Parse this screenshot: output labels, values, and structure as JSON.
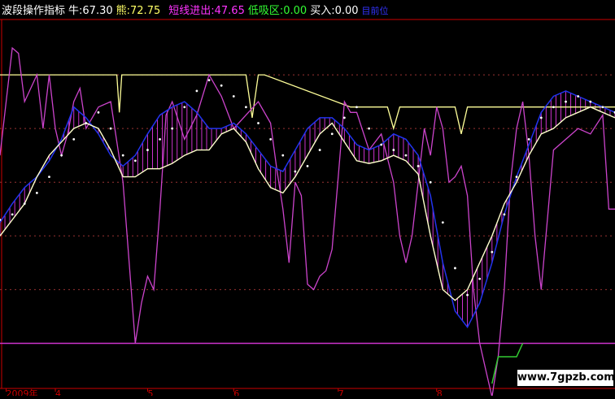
{
  "header": {
    "indicator_name": "波段操作指标",
    "niu_label": "牛:",
    "niu_value": "67.30",
    "neng_label": "熊:",
    "neng_value": "72.75",
    "short_label": "短线进出:",
    "short_value": "47.65",
    "low_label": "低吸区:",
    "low_value": "0.00",
    "buy_label": "买入:",
    "buy_value": "0.00",
    "last_label": "目前位"
  },
  "colors": {
    "background": "#000000",
    "header_name": "#ffffff",
    "niu": "#ffffff",
    "neng": "#ffff66",
    "short": "#ff33ff",
    "low": "#33ff33",
    "buy": "#ffffff",
    "last": "#3333ff",
    "hist": "#cc33cc",
    "magenta_line": "#cc44cc",
    "white_line": "#ffffcc",
    "blue_line": "#2233ee",
    "dots": "#ffffff",
    "yellow_band": "#ffff99",
    "level_line": "#cc33cc",
    "green_step": "#33cc33",
    "axis": "#cc0000",
    "grid": "#993333"
  },
  "x_axis_labels": [
    "2009年",
    "4",
    "5",
    "6",
    "7",
    "8"
  ],
  "watermark": "www.7gpzb.com",
  "chart_data": {
    "type": "line",
    "title": "波段操作指标",
    "x_range": [
      0,
      100
    ],
    "y_range": [
      -15,
      120
    ],
    "grid": true,
    "x_ticks": [
      {
        "x": 1,
        "label": "2009年"
      },
      {
        "x": 9,
        "label": "4"
      },
      {
        "x": 24,
        "label": "5"
      },
      {
        "x": 38,
        "label": "6"
      },
      {
        "x": 55,
        "label": "7"
      },
      {
        "x": 71,
        "label": "8"
      }
    ],
    "reference_levels": [
      100,
      80,
      60,
      40,
      20,
      0
    ],
    "series": [
      {
        "role": "magenta",
        "x": [
          0,
          2,
          3,
          4,
          5,
          6,
          7,
          8,
          9,
          10,
          11,
          12,
          13,
          14,
          16,
          18,
          20,
          21,
          22,
          23,
          24,
          25,
          26,
          27,
          28,
          30,
          32,
          34,
          36,
          38,
          40,
          42,
          44,
          45,
          46,
          47,
          48,
          49,
          50,
          51,
          52,
          53,
          54,
          55,
          56,
          57,
          58,
          60,
          62,
          64,
          65,
          66,
          67,
          68,
          69,
          70,
          71,
          72,
          73,
          74,
          75,
          76,
          77,
          78,
          79,
          80,
          81,
          82,
          83,
          84,
          85,
          86,
          87,
          88,
          90,
          92,
          94,
          96,
          98,
          99,
          100
        ],
        "y": [
          70,
          110,
          108,
          90,
          95,
          100,
          80,
          100,
          80,
          70,
          78,
          90,
          95,
          80,
          88,
          90,
          60,
          30,
          0,
          15,
          25,
          20,
          50,
          85,
          90,
          76,
          85,
          100,
          92,
          80,
          85,
          90,
          82,
          65,
          50,
          30,
          60,
          55,
          22,
          20,
          25,
          27,
          35,
          62,
          90,
          86,
          86,
          72,
          78,
          60,
          40,
          30,
          40,
          60,
          80,
          70,
          88,
          80,
          60,
          62,
          66,
          55,
          20,
          0,
          -10,
          -20,
          -5,
          20,
          60,
          80,
          90,
          70,
          40,
          20,
          72,
          76,
          80,
          78,
          85,
          50,
          50
        ]
      },
      {
        "role": "white",
        "x": [
          0,
          2,
          4,
          6,
          8,
          10,
          12,
          14,
          16,
          18,
          20,
          22,
          24,
          26,
          28,
          30,
          32,
          34,
          36,
          38,
          40,
          42,
          44,
          46,
          48,
          50,
          52,
          54,
          56,
          58,
          60,
          62,
          64,
          66,
          68,
          70,
          72,
          74,
          76,
          78,
          80,
          82,
          84,
          86,
          88,
          90,
          92,
          94,
          96,
          98,
          100
        ],
        "y": [
          40,
          46,
          52,
          62,
          70,
          75,
          80,
          82,
          80,
          72,
          62,
          62,
          65,
          65,
          67,
          70,
          72,
          72,
          78,
          80,
          75,
          65,
          58,
          56,
          62,
          70,
          78,
          82,
          75,
          68,
          67,
          68,
          70,
          68,
          63,
          40,
          20,
          16,
          20,
          30,
          40,
          52,
          60,
          70,
          78,
          80,
          84,
          86,
          88,
          86,
          84
        ]
      },
      {
        "role": "blue",
        "x": [
          0,
          2,
          4,
          6,
          8,
          10,
          12,
          14,
          16,
          18,
          20,
          22,
          24,
          26,
          28,
          30,
          32,
          34,
          36,
          38,
          40,
          42,
          44,
          46,
          48,
          50,
          52,
          54,
          56,
          58,
          60,
          62,
          64,
          66,
          68,
          70,
          72,
          74,
          76,
          78,
          80,
          82,
          84,
          86,
          88,
          90,
          92,
          94,
          96,
          98,
          100
        ],
        "y": [
          45,
          52,
          58,
          62,
          68,
          76,
          88,
          84,
          78,
          70,
          66,
          70,
          78,
          85,
          88,
          90,
          86,
          80,
          80,
          82,
          78,
          72,
          66,
          64,
          72,
          80,
          84,
          84,
          80,
          74,
          72,
          74,
          78,
          76,
          70,
          55,
          30,
          12,
          6,
          15,
          30,
          48,
          62,
          74,
          86,
          92,
          94,
          92,
          90,
          88,
          86
        ]
      },
      {
        "role": "dots",
        "x": [
          0,
          2,
          4,
          6,
          8,
          10,
          12,
          14,
          16,
          18,
          20,
          22,
          24,
          26,
          28,
          30,
          32,
          34,
          36,
          38,
          40,
          42,
          44,
          46,
          48,
          50,
          52,
          54,
          56,
          58,
          60,
          62,
          64,
          66,
          68,
          70,
          72,
          74,
          76,
          78,
          80,
          82,
          84,
          86,
          88,
          90,
          92,
          94,
          96,
          98,
          100
        ],
        "y": [
          46,
          48,
          52,
          56,
          62,
          70,
          76,
          82,
          86,
          80,
          70,
          68,
          72,
          76,
          80,
          88,
          94,
          98,
          96,
          92,
          88,
          82,
          76,
          70,
          64,
          66,
          72,
          78,
          84,
          88,
          80,
          74,
          72,
          70,
          66,
          60,
          45,
          28,
          18,
          24,
          34,
          48,
          62,
          76,
          84,
          88,
          90,
          92,
          90,
          88,
          86
        ]
      },
      {
        "role": "yellow_band",
        "x": [
          0,
          19,
          19.4,
          19.8,
          40,
          41,
          42,
          43,
          57,
          58,
          63,
          64,
          65,
          66,
          74,
          75,
          76,
          100
        ],
        "y": [
          100,
          100,
          86,
          100,
          100,
          84,
          100,
          100,
          88,
          88,
          88,
          80,
          88,
          88,
          88,
          78,
          88,
          88
        ]
      },
      {
        "role": "green_step",
        "x": [
          80,
          81,
          82,
          84,
          85
        ],
        "y": [
          -15,
          -5,
          -5,
          -5,
          0
        ]
      }
    ]
  }
}
